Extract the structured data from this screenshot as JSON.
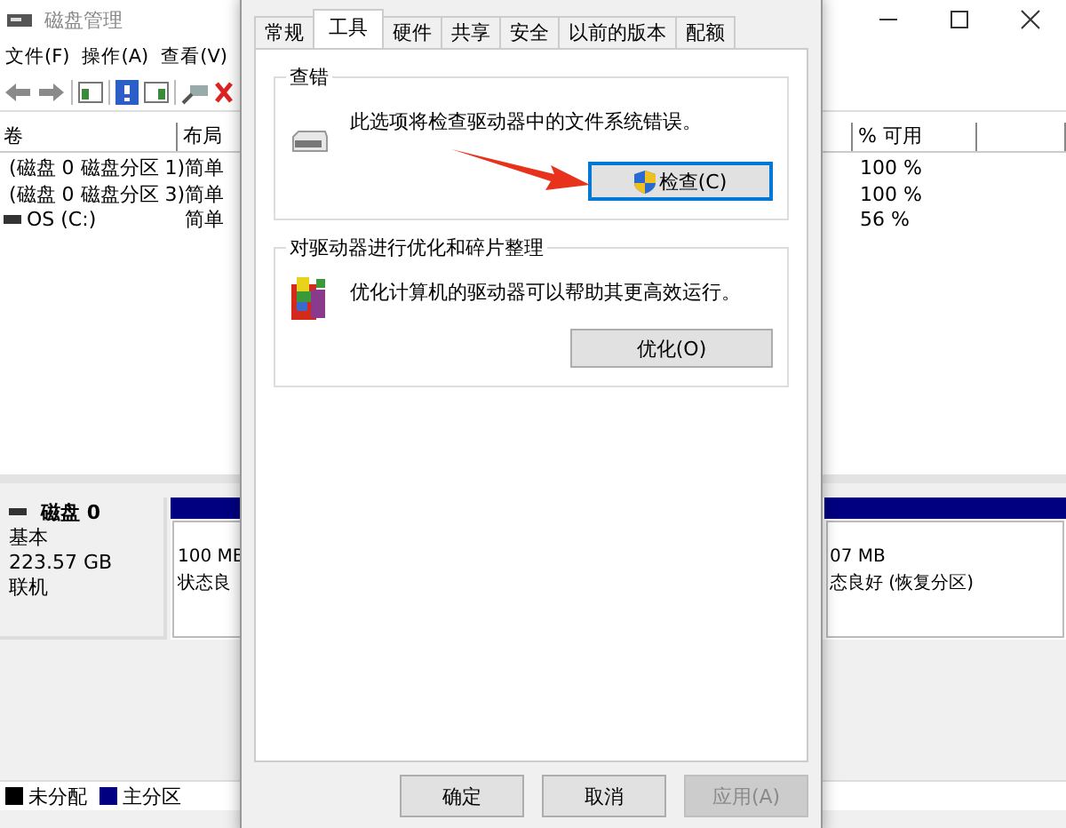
{
  "window": {
    "title": "磁盘管理"
  },
  "menu": [
    "文件(F)",
    "操作(A)",
    "查看(V)"
  ],
  "volume_table": {
    "columns": [
      "卷",
      "布局",
      "% 可用"
    ],
    "rows": [
      {
        "volume": "(磁盘 0 磁盘分区 1)",
        "layout": "简单",
        "free": "100 %"
      },
      {
        "volume": "(磁盘 0 磁盘分区 3)",
        "layout": "简单",
        "free": "100 %"
      },
      {
        "volume": "OS (C:)",
        "layout": "简单",
        "free": "56 %"
      }
    ]
  },
  "disk": {
    "name": "磁盘 0",
    "type": "基本",
    "size": "223.57 GB",
    "status": "联机",
    "partitions": [
      {
        "size": "100 MB",
        "status": "状态良"
      },
      {
        "size": "07 MB",
        "status": "态良好 (恢复分区)"
      }
    ]
  },
  "legend": [
    {
      "label": "未分配",
      "color": "#000000"
    },
    {
      "label": "主分区",
      "color": "#000080"
    }
  ],
  "dialog": {
    "tabs": [
      {
        "label": "常规",
        "selected": false
      },
      {
        "label": "工具",
        "selected": true
      },
      {
        "label": "硬件",
        "selected": false
      },
      {
        "label": "共享",
        "selected": false
      },
      {
        "label": "安全",
        "selected": false
      },
      {
        "label": "以前的版本",
        "selected": false
      },
      {
        "label": "配额",
        "selected": false
      }
    ],
    "groups": [
      {
        "kind": "check",
        "title": "查错",
        "description": "此选项将检查驱动器中的文件系统错误。",
        "button": "检查(C)",
        "focused": true
      },
      {
        "kind": "optimize",
        "title": "对驱动器进行优化和碎片整理",
        "description": "优化计算机的驱动器可以帮助其更高效运行。",
        "button": "优化(O)",
        "focused": false
      }
    ],
    "buttons": [
      {
        "label": "确定",
        "disabled": false
      },
      {
        "label": "取消",
        "disabled": false
      },
      {
        "label": "应用(A)",
        "disabled": true
      }
    ]
  }
}
